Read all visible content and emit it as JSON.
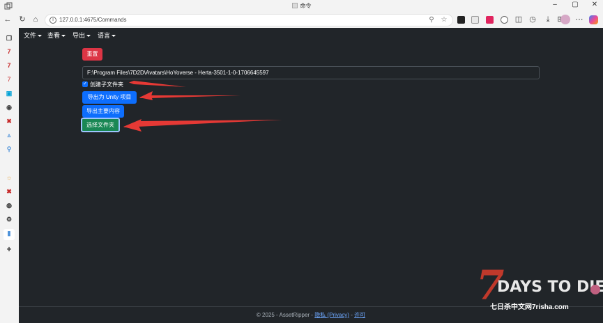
{
  "browser": {
    "tab_title": "命令",
    "url": "127.0.0.1:4675/Commands"
  },
  "menu": [
    {
      "label": "文件"
    },
    {
      "label": "查看"
    },
    {
      "label": "导出"
    },
    {
      "label": "语言"
    }
  ],
  "commands": {
    "reset_label": "重置",
    "path_value": "F:\\Program Files\\7D2D\\Avatars\\HoYoverse - Herta-3501-1-0-1706645597",
    "checkbox_label": "创建子文件夹",
    "checkbox_checked": true,
    "export_unity_label": "导出为 Unity 项目",
    "export_primary_label": "导出主要内容",
    "select_folder_label": "选择文件夹"
  },
  "footer": {
    "copyright": "© 2025 - AssetRipper - ",
    "privacy_label": "隐私 (Privacy)",
    "separator": " - ",
    "license_label": "许可"
  },
  "watermark": {
    "seven": "7",
    "days": "DAYS TO DIE",
    "sub": "七日杀中文网7risha.com"
  },
  "colors": {
    "app_bg": "#212529",
    "danger": "#dc3545",
    "primary": "#0d6efd",
    "success": "#198754",
    "arrow": "#e53935"
  }
}
